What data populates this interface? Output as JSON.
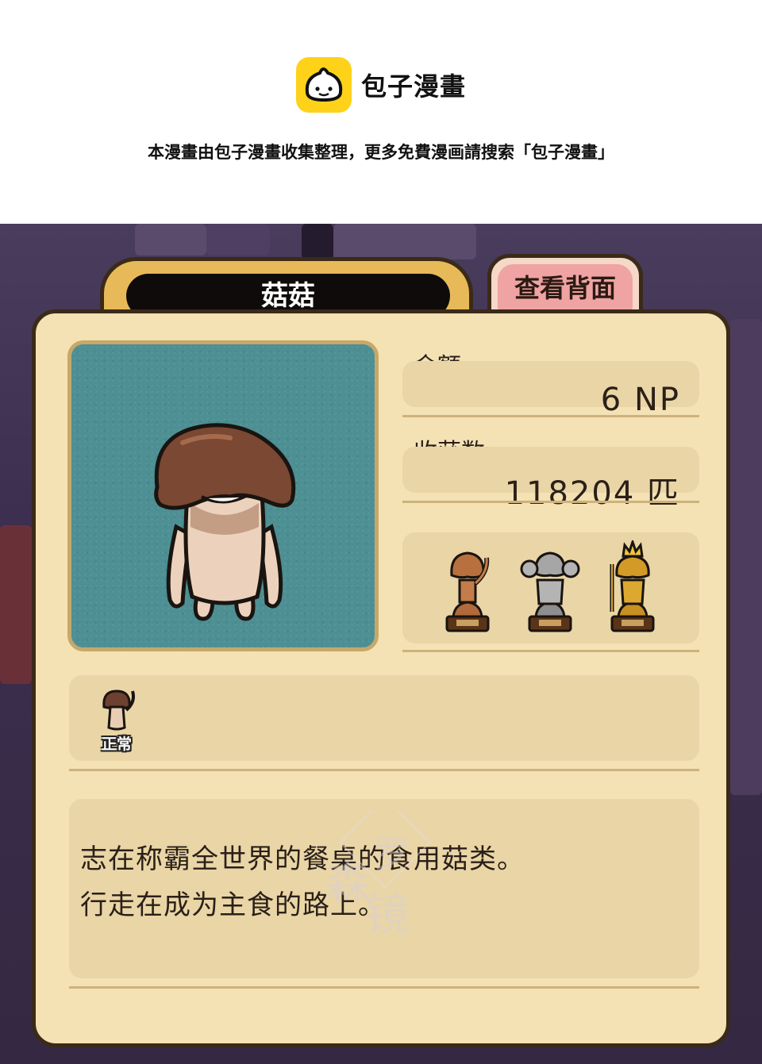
{
  "header": {
    "app_name": "包子漫畫",
    "notice": "本漫畫由包子漫畫收集整理，更多免費漫画請搜索「包子漫畫」"
  },
  "card": {
    "name": "菇菇",
    "back_view_label": "查看背面",
    "money": {
      "label": "金额",
      "value": "6 NP"
    },
    "harvest": {
      "label": "收获数",
      "value": "118204 匹"
    },
    "trophies": [
      "bronze-trophy-icon",
      "silver-trophy-icon",
      "gold-trophy-icon"
    ],
    "status": {
      "label": "正常",
      "icon": "mushroom-status-icon"
    },
    "description": [
      "志在称霸全世界的餐桌的食用菇类。",
      "行走在成为主食的路上。"
    ]
  },
  "colors": {
    "logo_yellow": "#ffd21a",
    "card_bg": "#f4e2b5",
    "panel_bg": "#e9d5a6",
    "portrait_bg": "#4d8f93",
    "tab_gold": "#e7b958",
    "tab_pink": "#f0a3a3"
  }
}
